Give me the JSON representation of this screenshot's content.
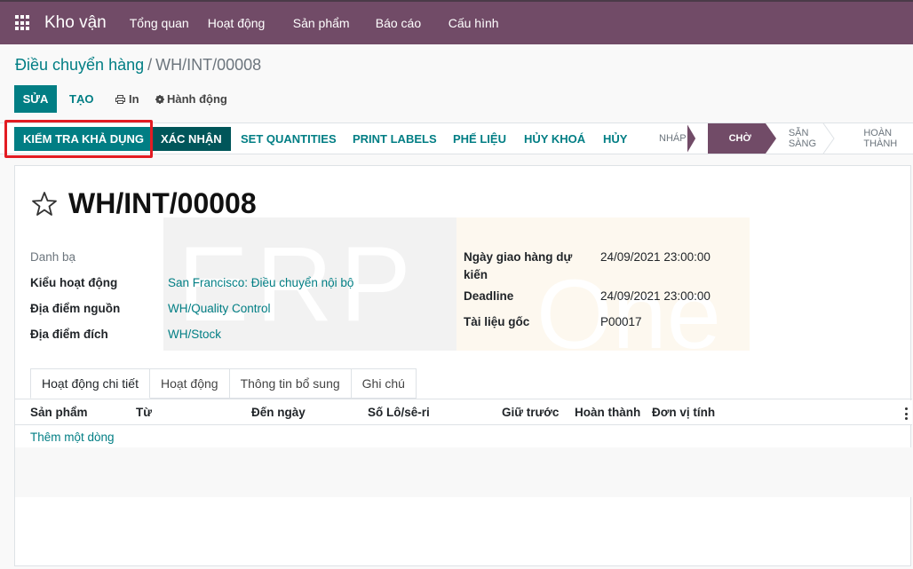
{
  "navbar": {
    "app_name": "Kho vận",
    "menu": [
      "Tổng quan",
      "Hoạt động",
      "Sản phẩm",
      "Báo cáo",
      "Cấu hình"
    ]
  },
  "breadcrumb": {
    "parent": "Điều chuyển hàng",
    "separator": "/",
    "current": "WH/INT/00008"
  },
  "controls": {
    "edit": "SỬA",
    "create": "TẠO",
    "print": "In",
    "action": "Hành động"
  },
  "statusbar": {
    "buttons": [
      "KIỂM TRA KHẢ DỤNG",
      "XÁC NHẬN",
      "SET QUANTITIES",
      "PRINT LABELS",
      "PHẾ LIỆU",
      "HỦY KHOÁ",
      "HỦY"
    ],
    "stages": [
      "NHÁP",
      "CHỜ",
      "SẴN SÀNG",
      "HOÀN THÀNH"
    ],
    "active_stage": "CHỜ"
  },
  "watermark": {
    "left": "ERP",
    "right": "One"
  },
  "record": {
    "title": "WH/INT/00008",
    "left_fields": [
      {
        "label": "Danh bạ",
        "value": ""
      },
      {
        "label": "Kiểu hoạt động",
        "value": "San Francisco: Điều chuyển nội bộ"
      },
      {
        "label": "Địa điểm nguồn",
        "value": "WH/Quality Control"
      },
      {
        "label": "Địa điểm đích",
        "value": "WH/Stock"
      }
    ],
    "right_fields": [
      {
        "label": "Ngày giao hàng dự kiến",
        "label_line1": "Ngày giao hàng dự",
        "label_line2": "kiến",
        "value": "24/09/2021 23:00:00"
      },
      {
        "label": "Deadline",
        "value": "24/09/2021 23:00:00"
      },
      {
        "label": "Tài liệu gốc",
        "value": "P00017"
      }
    ]
  },
  "tabs": [
    "Hoạt động chi tiết",
    "Hoạt động",
    "Thông tin bổ sung",
    "Ghi chú"
  ],
  "table": {
    "columns": [
      "Sản phẩm",
      "Từ",
      "Đến ngày",
      "Số Lô/sê-ri",
      "Giữ trước",
      "Hoàn thành",
      "Đơn vị tính"
    ],
    "add_line": "Thêm một dòng"
  },
  "colors": {
    "brand": "#714B67",
    "primary": "#017e84",
    "highlight": "#e31c23"
  }
}
